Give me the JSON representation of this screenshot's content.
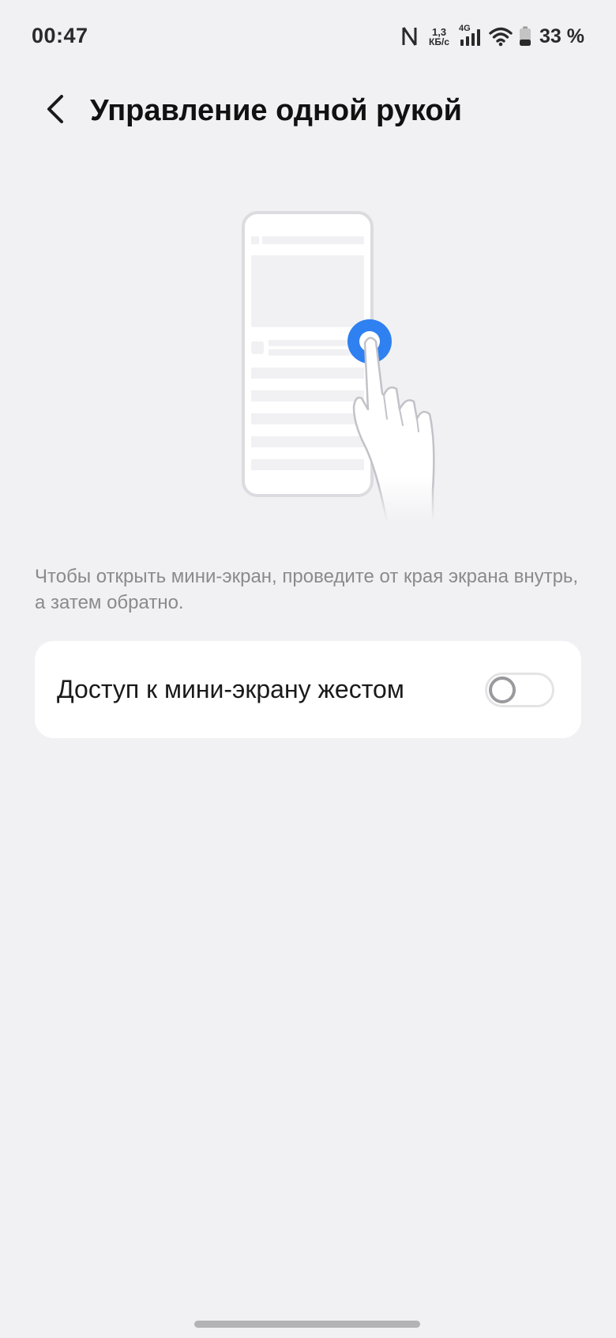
{
  "status_bar": {
    "time": "00:47",
    "net_speed_value": "1,3",
    "net_speed_unit": "КБ/с",
    "network_type": "4G",
    "battery": "33 %",
    "icons": [
      "nfc-icon",
      "signal-icon",
      "wifi-icon",
      "battery-icon"
    ]
  },
  "header": {
    "back_icon": "chevron-left-icon",
    "title": "Управление одной рукой"
  },
  "illustration": {
    "icon": "one-hand-gesture-illustration",
    "accent_color": "#2f80f0"
  },
  "description": "Чтобы открыть мини-экран, проведите от края экрана внутрь, а затем обратно.",
  "settings": [
    {
      "label": "Доступ к мини-экрану жестом",
      "enabled": false
    }
  ],
  "colors": {
    "background": "#f1f1f4",
    "card": "#ffffff",
    "secondary_text": "#8a8a8e",
    "accent": "#2f80f0"
  }
}
